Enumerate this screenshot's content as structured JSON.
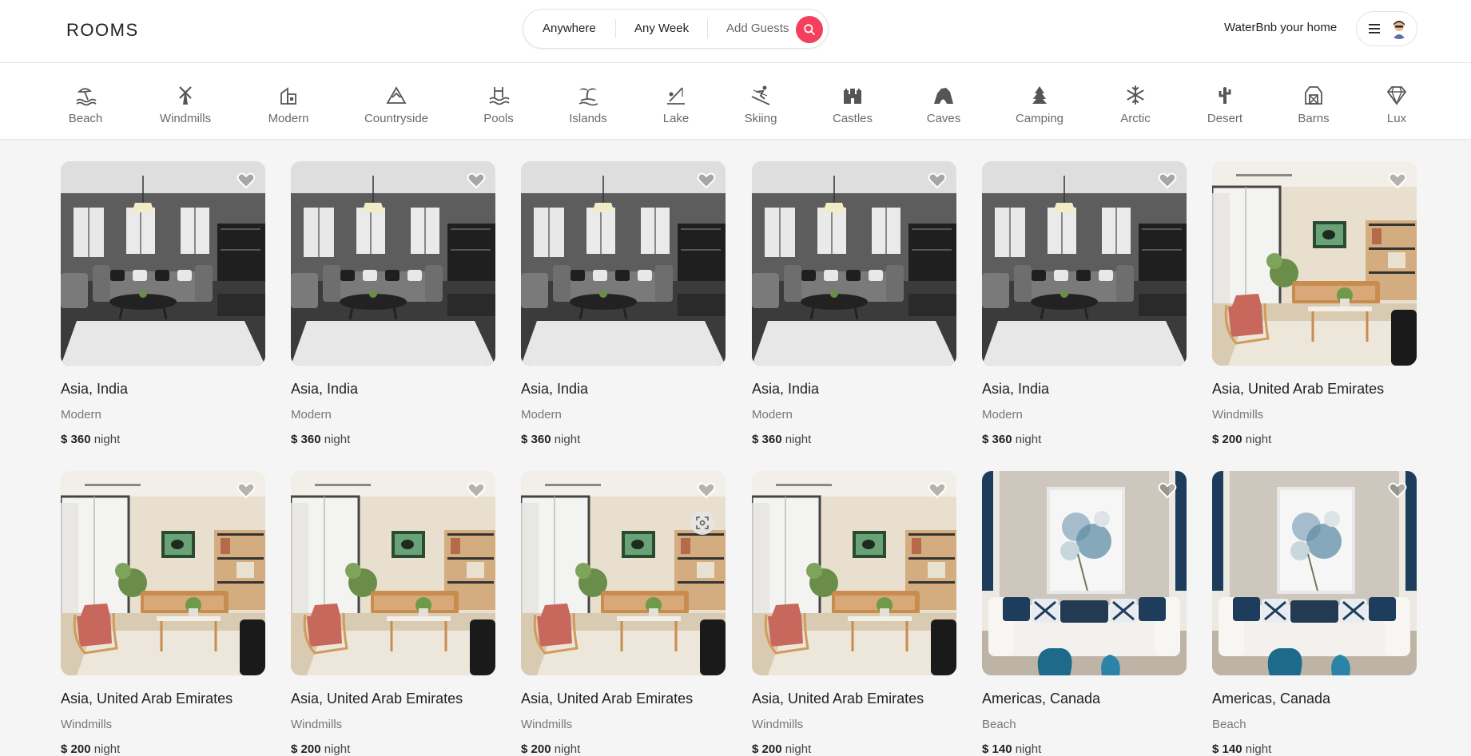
{
  "header": {
    "logo": "ROOMS",
    "search": {
      "anywhere": "Anywhere",
      "any_week": "Any Week",
      "add_guests": "Add Guests"
    },
    "host_link": "WaterBnb your home",
    "menu_icon": "hamburger-icon"
  },
  "categories": [
    {
      "label": "Beach",
      "icon": "beach-icon"
    },
    {
      "label": "Windmills",
      "icon": "windmill-icon"
    },
    {
      "label": "Modern",
      "icon": "modern-icon"
    },
    {
      "label": "Countryside",
      "icon": "mountain-icon"
    },
    {
      "label": "Pools",
      "icon": "pool-icon"
    },
    {
      "label": "Islands",
      "icon": "island-icon"
    },
    {
      "label": "Lake",
      "icon": "lake-icon"
    },
    {
      "label": "Skiing",
      "icon": "skiing-icon"
    },
    {
      "label": "Castles",
      "icon": "castle-icon"
    },
    {
      "label": "Caves",
      "icon": "cave-icon"
    },
    {
      "label": "Camping",
      "icon": "camping-icon"
    },
    {
      "label": "Arctic",
      "icon": "snowflake-icon"
    },
    {
      "label": "Desert",
      "icon": "cactus-icon"
    },
    {
      "label": "Barns",
      "icon": "barn-icon"
    },
    {
      "label": "Lux",
      "icon": "diamond-icon"
    }
  ],
  "listings": [
    {
      "location": "Asia, India",
      "category": "Modern",
      "price": "$ 360",
      "per": "night",
      "photo": "gray-living-room"
    },
    {
      "location": "Asia, India",
      "category": "Modern",
      "price": "$ 360",
      "per": "night",
      "photo": "gray-living-room"
    },
    {
      "location": "Asia, India",
      "category": "Modern",
      "price": "$ 360",
      "per": "night",
      "photo": "gray-living-room"
    },
    {
      "location": "Asia, India",
      "category": "Modern",
      "price": "$ 360",
      "per": "night",
      "photo": "gray-living-room"
    },
    {
      "location": "Asia, India",
      "category": "Modern",
      "price": "$ 360",
      "per": "night",
      "photo": "gray-living-room"
    },
    {
      "location": "Asia, United Arab Emirates",
      "category": "Windmills",
      "price": "$ 200",
      "per": "night",
      "photo": "bright-living-room"
    },
    {
      "location": "Asia, United Arab Emirates",
      "category": "Windmills",
      "price": "$ 200",
      "per": "night",
      "photo": "bright-living-room"
    },
    {
      "location": "Asia, United Arab Emirates",
      "category": "Windmills",
      "price": "$ 200",
      "per": "night",
      "photo": "bright-living-room"
    },
    {
      "location": "Asia, United Arab Emirates",
      "category": "Windmills",
      "price": "$ 200",
      "per": "night",
      "photo": "bright-living-room"
    },
    {
      "location": "Asia, United Arab Emirates",
      "category": "Windmills",
      "price": "$ 200",
      "per": "night",
      "photo": "bright-living-room"
    },
    {
      "location": "Americas, Canada",
      "category": "Beach",
      "price": "$ 140",
      "per": "night",
      "photo": "white-sofa-room"
    },
    {
      "location": "Americas, Canada",
      "category": "Beach",
      "price": "$ 140",
      "per": "night",
      "photo": "white-sofa-room"
    }
  ],
  "colors": {
    "accent": "#f43f5e",
    "background": "#f5f5f5"
  }
}
